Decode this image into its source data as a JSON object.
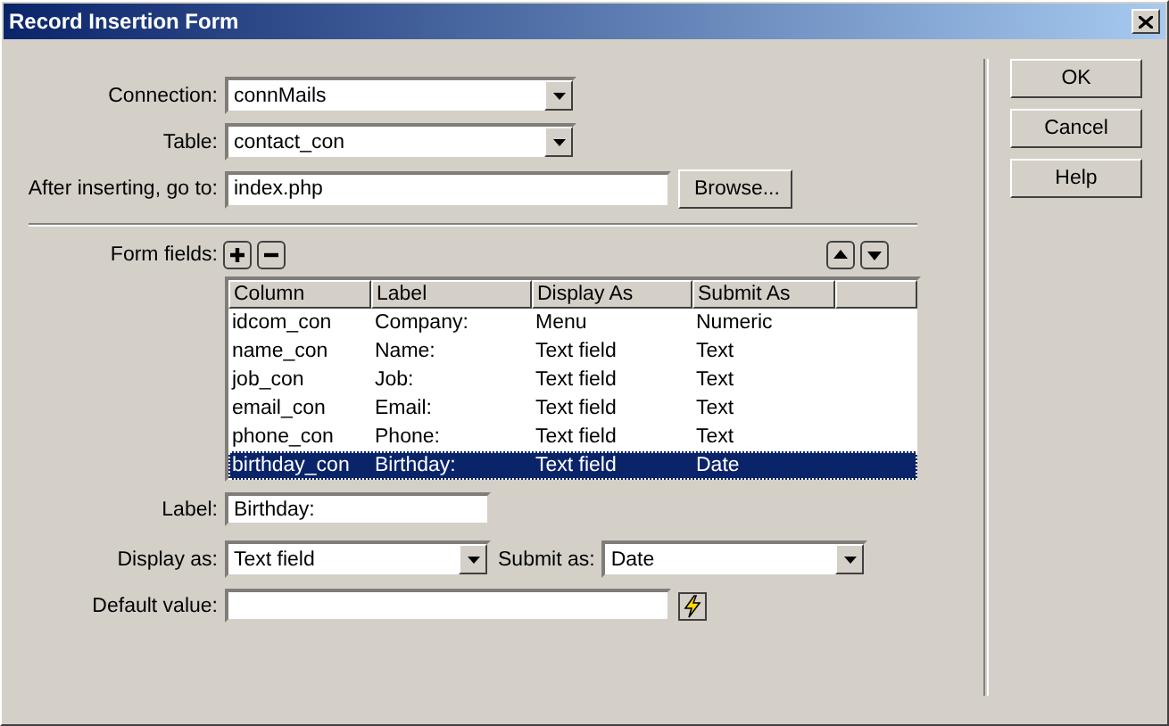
{
  "window": {
    "title": "Record Insertion Form"
  },
  "connection": {
    "label": "Connection:",
    "value": "connMails"
  },
  "table": {
    "label": "Table:",
    "value": "contact_con"
  },
  "after_inserting": {
    "label": "After inserting, go to:",
    "value": "index.php",
    "button": "Browse..."
  },
  "form_fields": {
    "label": "Form fields:",
    "columns": [
      "Column",
      "Label",
      "Display As",
      "Submit As"
    ],
    "rows": [
      {
        "cells": [
          "idcom_con",
          "Company:",
          "Menu",
          "Numeric"
        ],
        "selected": false
      },
      {
        "cells": [
          "name_con",
          "Name:",
          "Text field",
          "Text"
        ],
        "selected": false
      },
      {
        "cells": [
          "job_con",
          "Job:",
          "Text field",
          "Text"
        ],
        "selected": false
      },
      {
        "cells": [
          "email_con",
          "Email:",
          "Text field",
          "Text"
        ],
        "selected": false
      },
      {
        "cells": [
          "phone_con",
          "Phone:",
          "Text field",
          "Text"
        ],
        "selected": false
      },
      {
        "cells": [
          "birthday_con",
          "Birthday:",
          "Text field",
          "Date"
        ],
        "selected": true
      }
    ]
  },
  "label_field": {
    "label": "Label:",
    "value": "Birthday:"
  },
  "display_as": {
    "label": "Display as:",
    "value": "Text field"
  },
  "submit_as": {
    "label": "Submit as:",
    "value": "Date"
  },
  "default_value": {
    "label": "Default value:"
  },
  "buttons": [
    "OK",
    "Cancel",
    "Help"
  ]
}
